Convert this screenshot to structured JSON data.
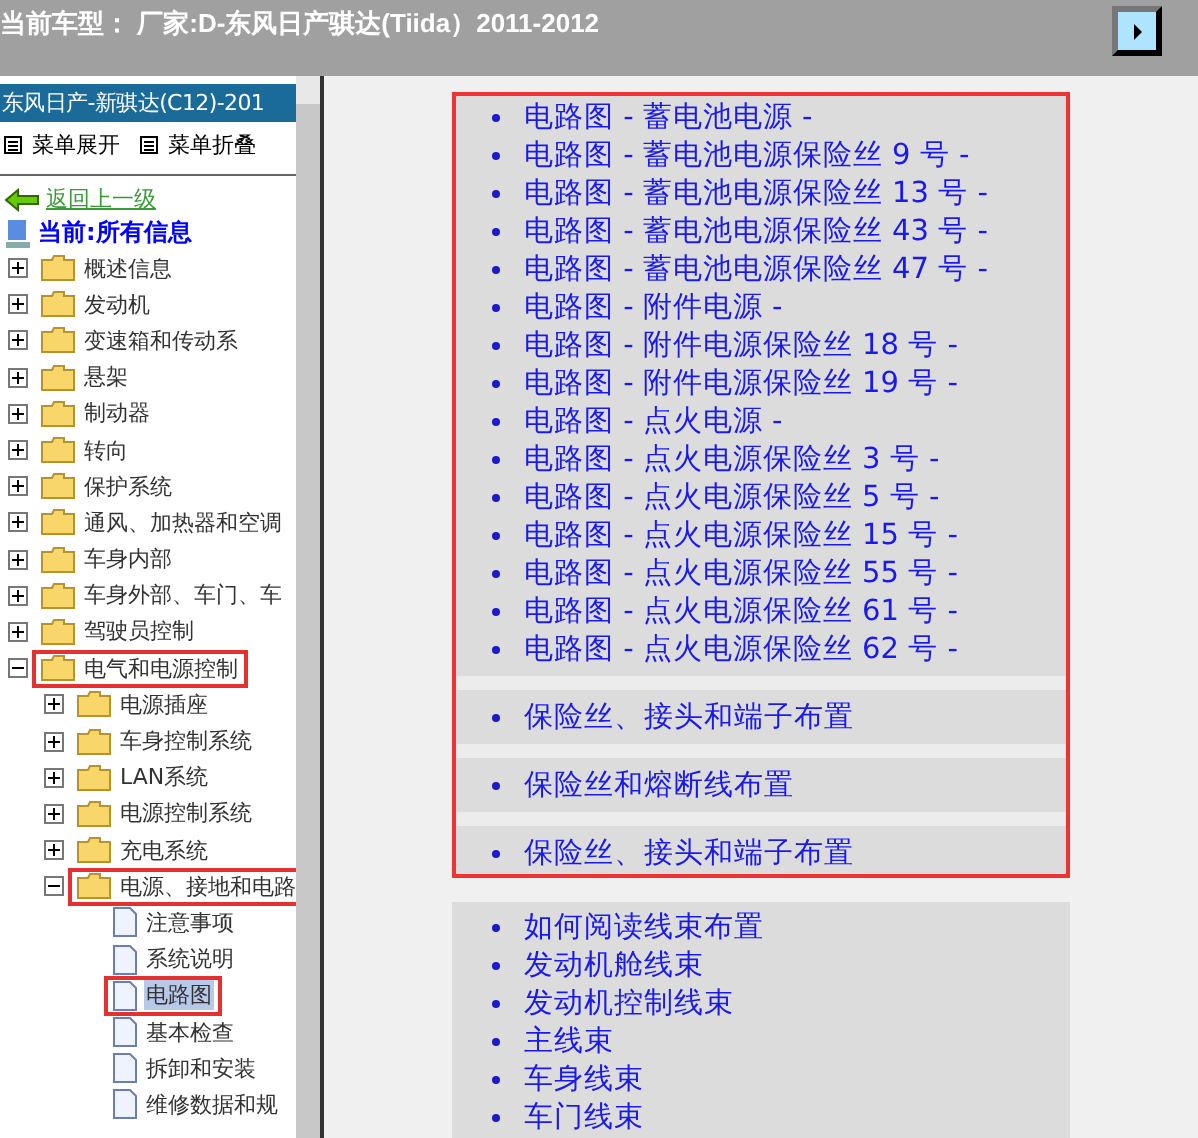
{
  "title": "当前车型： 厂家:D-东风日产骐达(Tiida）2011-2012",
  "sidebar": {
    "header": "东风日产-新骐达(C12)-201",
    "menu": [
      "菜单展开",
      "菜单折叠"
    ],
    "back_link": "返回上一级",
    "current": "当前:所有信息",
    "tree": [
      {
        "label": "概述信息",
        "kind": "folder",
        "expanded": false,
        "highlighted": false,
        "selected": false
      },
      {
        "label": "发动机",
        "kind": "folder",
        "expanded": false,
        "highlighted": false,
        "selected": false
      },
      {
        "label": "变速箱和传动系",
        "kind": "folder",
        "expanded": false,
        "highlighted": false,
        "selected": false
      },
      {
        "label": "悬架",
        "kind": "folder",
        "expanded": false,
        "highlighted": false,
        "selected": false
      },
      {
        "label": "制动器",
        "kind": "folder",
        "expanded": false,
        "highlighted": false,
        "selected": false
      },
      {
        "label": "转向",
        "kind": "folder",
        "expanded": false,
        "highlighted": false,
        "selected": false
      },
      {
        "label": "保护系统",
        "kind": "folder",
        "expanded": false,
        "highlighted": false,
        "selected": false
      },
      {
        "label": "通风、加热器和空调",
        "kind": "folder",
        "expanded": false,
        "highlighted": false,
        "selected": false
      },
      {
        "label": "车身内部",
        "kind": "folder",
        "expanded": false,
        "highlighted": false,
        "selected": false
      },
      {
        "label": "车身外部、车门、车",
        "kind": "folder",
        "expanded": false,
        "highlighted": false,
        "selected": false
      },
      {
        "label": "驾驶员控制",
        "kind": "folder",
        "expanded": false,
        "highlighted": false,
        "selected": false
      },
      {
        "label": "电气和电源控制",
        "kind": "folder",
        "expanded": true,
        "highlighted": true,
        "selected": false,
        "children": [
          {
            "label": "电源插座",
            "kind": "folder",
            "expanded": false,
            "highlighted": false,
            "selected": false
          },
          {
            "label": "车身控制系统",
            "kind": "folder",
            "expanded": false,
            "highlighted": false,
            "selected": false
          },
          {
            "label": "LAN系统",
            "kind": "folder",
            "expanded": false,
            "highlighted": false,
            "selected": false
          },
          {
            "label": "电源控制系统",
            "kind": "folder",
            "expanded": false,
            "highlighted": false,
            "selected": false
          },
          {
            "label": "充电系统",
            "kind": "folder",
            "expanded": false,
            "highlighted": false,
            "selected": false
          },
          {
            "label": "电源、接地和电路",
            "kind": "folder",
            "expanded": true,
            "highlighted": true,
            "selected": false,
            "children": [
              {
                "label": "注意事项",
                "kind": "page",
                "highlighted": false,
                "selected": false
              },
              {
                "label": "系统说明",
                "kind": "page",
                "highlighted": false,
                "selected": false
              },
              {
                "label": "电路图",
                "kind": "page",
                "highlighted": true,
                "selected": true
              },
              {
                "label": "基本检查",
                "kind": "page",
                "highlighted": false,
                "selected": false
              },
              {
                "label": "拆卸和安装",
                "kind": "page",
                "highlighted": false,
                "selected": false
              },
              {
                "label": "维修数据和规",
                "kind": "page",
                "highlighted": false,
                "selected": false
              }
            ]
          }
        ]
      }
    ]
  },
  "content": [
    {
      "highlighted": true,
      "groups": [
        [
          "电路图 - 蓄电池电源 -",
          "电路图 - 蓄电池电源保险丝 9 号 -",
          "电路图 - 蓄电池电源保险丝 13 号 -",
          "电路图 - 蓄电池电源保险丝 43 号 -",
          "电路图 - 蓄电池电源保险丝 47 号 -",
          "电路图 - 附件电源 -",
          "电路图 - 附件电源保险丝 18 号 -",
          "电路图 - 附件电源保险丝 19 号 -",
          "电路图 - 点火电源 -",
          "电路图 - 点火电源保险丝 3 号 -",
          "电路图 - 点火电源保险丝 5 号 -",
          "电路图 - 点火电源保险丝 15 号 -",
          "电路图 - 点火电源保险丝 55 号 -",
          "电路图 - 点火电源保险丝 61 号 -",
          "电路图 - 点火电源保险丝 62 号 -"
        ],
        [
          "保险丝、接头和端子布置"
        ],
        [
          "保险丝和熔断线布置"
        ],
        [
          "保险丝、接头和端子布置"
        ]
      ]
    },
    {
      "highlighted": false,
      "groups": [
        [
          "如何阅读线束布置",
          "发动机舱线束",
          "发动机控制线束",
          "主线束",
          "车身线束",
          "车门线束"
        ]
      ]
    }
  ]
}
